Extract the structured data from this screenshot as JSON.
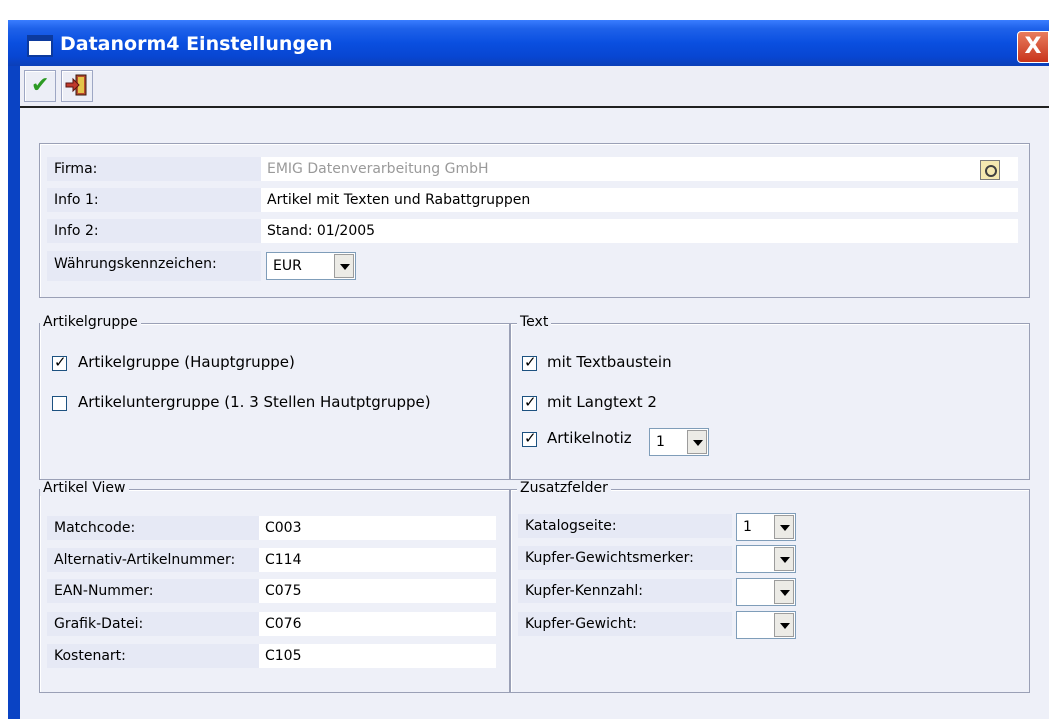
{
  "window": {
    "title": "Datanorm4 Einstellungen",
    "close_label": "X",
    "colors": {
      "titlebar": "#0a4fe0",
      "client": "#eef0f8",
      "label_bg": "#e6e9f5"
    }
  },
  "toolbar": {
    "buttons": [
      {
        "name": "ok-button",
        "icon": "checkmark-icon"
      },
      {
        "name": "exit-button",
        "icon": "exit-door-icon"
      }
    ]
  },
  "header": {
    "firma_label": "Firma:",
    "firma_value": "EMIG Datenverarbeitung GmbH",
    "info1_label": "Info 1:",
    "info1_value": "Artikel mit Texten und Rabattgruppen",
    "info2_label": "Info 2:",
    "info2_value": "Stand: 01/2005",
    "currency_label": "Währungskennzeichen:",
    "currency_value": "EUR"
  },
  "artikelgruppe": {
    "legend": "Artikelgruppe",
    "options": [
      {
        "label": "Artikelgruppe (Hauptgruppe)",
        "checked": true
      },
      {
        "label": "Artikeluntergruppe (1. 3 Stellen Hautptgruppe)",
        "checked": false
      }
    ]
  },
  "text": {
    "legend": "Text",
    "options": [
      {
        "label": "mit Textbaustein",
        "checked": true
      },
      {
        "label": "mit Langtext 2",
        "checked": true
      },
      {
        "label": "Artikelnotiz",
        "checked": true
      }
    ],
    "artikelnotiz_value": "1"
  },
  "artikel_view": {
    "legend": "Artikel View",
    "rows": [
      {
        "label": "Matchcode:",
        "value": "C003"
      },
      {
        "label": "Alternativ-Artikelnummer:",
        "value": "C114"
      },
      {
        "label": "EAN-Nummer:",
        "value": "C075"
      },
      {
        "label": "Grafik-Datei:",
        "value": "C076"
      },
      {
        "label": "Kostenart:",
        "value": "C105"
      }
    ]
  },
  "zusatzfelder": {
    "legend": "Zusatzfelder",
    "rows": [
      {
        "label": "Katalogseite:",
        "value": "1"
      },
      {
        "label": "Kupfer-Gewichtsmerker:",
        "value": ""
      },
      {
        "label": "Kupfer-Kennzahl:",
        "value": ""
      },
      {
        "label": "Kupfer-Gewicht:",
        "value": ""
      }
    ]
  }
}
